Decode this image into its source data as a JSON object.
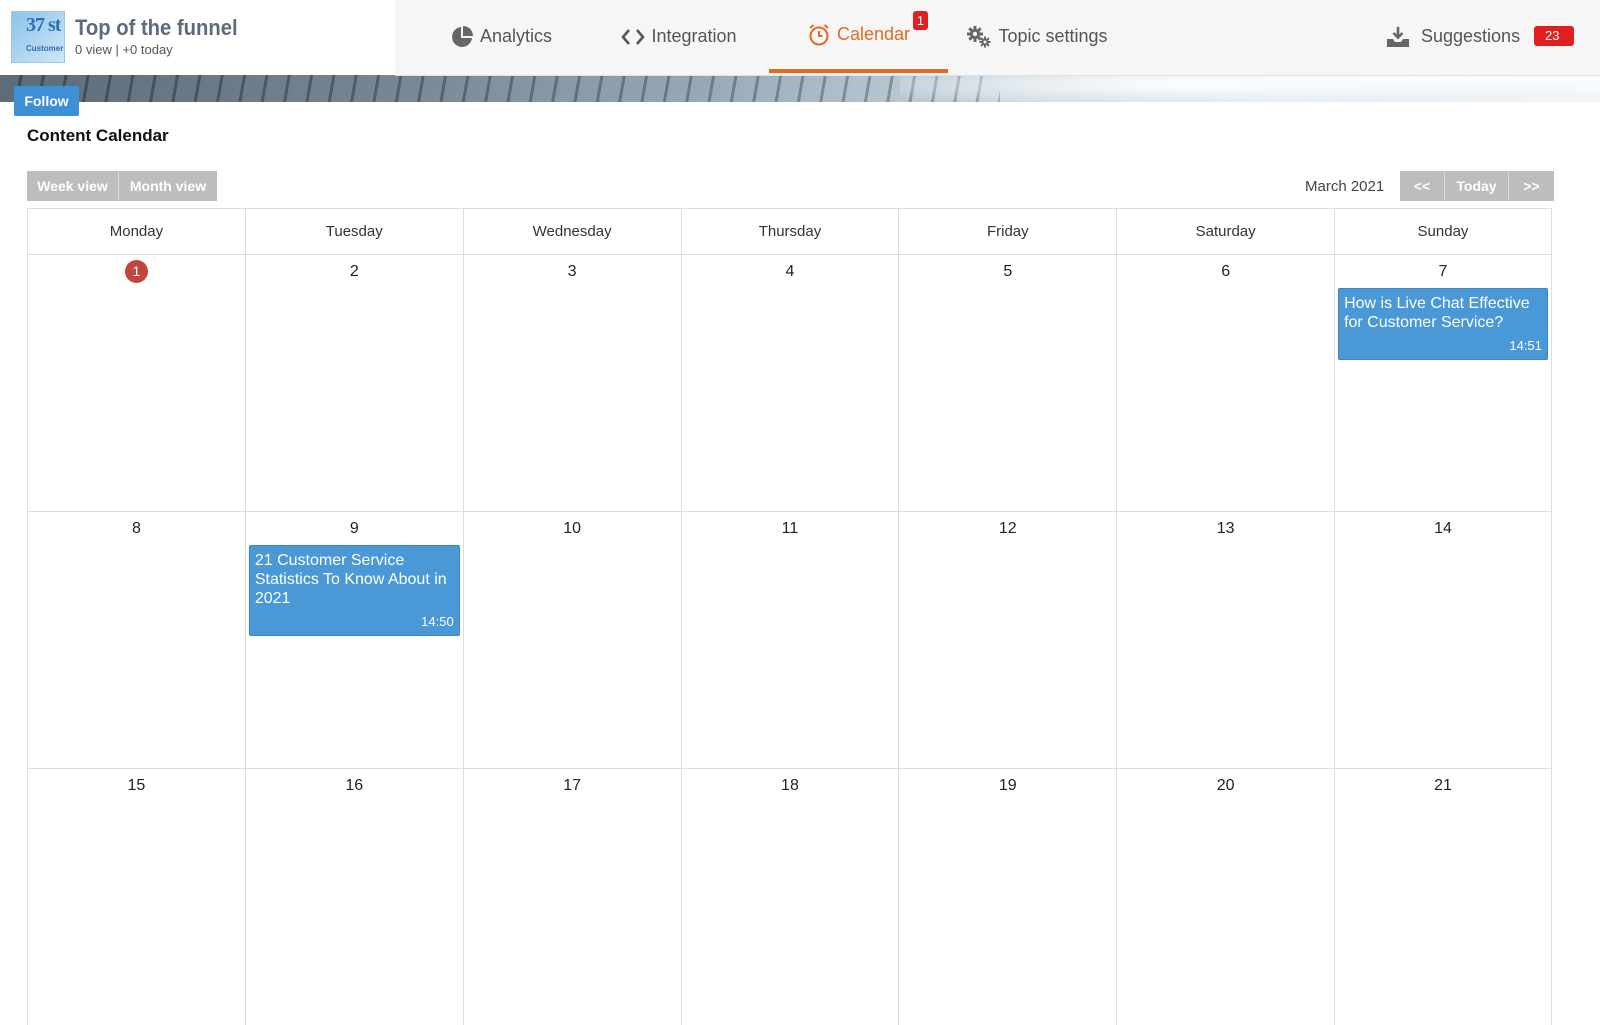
{
  "topic": {
    "logo_text_1": "37 st",
    "logo_text_2": "Customer S",
    "title": "Top of the funnel",
    "stats": "0 view | +0 today"
  },
  "nav": {
    "analytics": "Analytics",
    "integration": "Integration",
    "calendar": "Calendar",
    "calendar_badge": "1",
    "topic_settings": "Topic settings",
    "suggestions": "Suggestions",
    "suggestions_badge": "23"
  },
  "follow_label": "Follow",
  "page_title": "Content Calendar",
  "view_toggle": {
    "week": "Week view",
    "month": "Month view"
  },
  "month_label": "March 2021",
  "pager": {
    "prev": "<<",
    "today": "Today",
    "next": ">>"
  },
  "weekdays": [
    "Monday",
    "Tuesday",
    "Wednesday",
    "Thursday",
    "Friday",
    "Saturday",
    "Sunday"
  ],
  "weeks": [
    [
      "1",
      "2",
      "3",
      "4",
      "5",
      "6",
      "7"
    ],
    [
      "8",
      "9",
      "10",
      "11",
      "12",
      "13",
      "14"
    ],
    [
      "15",
      "16",
      "17",
      "18",
      "19",
      "20",
      "21"
    ]
  ],
  "today": "1",
  "events": {
    "mar7": {
      "title": "How is Live Chat Effective for Customer Service?",
      "time": "14:51"
    },
    "mar9": {
      "title": "21 Customer Service Statistics To Know About in 2021",
      "time": "14:50"
    }
  },
  "colors": {
    "accent": "#e06b22",
    "event": "#4a98d6",
    "badge": "#e02020",
    "today": "#c0453f"
  }
}
